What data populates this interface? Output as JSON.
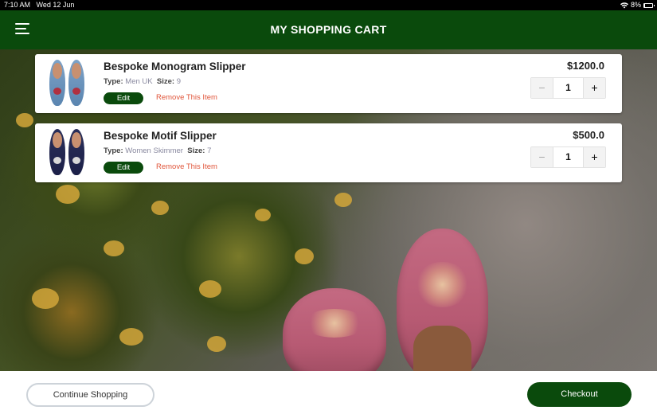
{
  "status_bar": {
    "time": "7:10 AM",
    "date": "Wed 12 Jun",
    "battery": "8%",
    "battery_level": 0.08,
    "wifi_icon": "wifi-icon"
  },
  "header": {
    "title": "MY SHOPPING CART",
    "menu_icon": "hamburger-menu-icon",
    "background_color": "#0a4a0c"
  },
  "cart": {
    "items": [
      {
        "name": "Bespoke Monogram Slipper",
        "type_label": "Type:",
        "type_value": "Men UK",
        "size_label": "Size:",
        "size_value": "9",
        "price": "$1200.0",
        "quantity": "1",
        "edit_label": "Edit",
        "remove_label": "Remove This Item",
        "minus_label": "−",
        "plus_label": "+"
      },
      {
        "name": "Bespoke Motif Slipper",
        "type_label": "Type:",
        "type_value": "Women Skimmer",
        "size_label": "Size:",
        "size_value": "7",
        "price": "$500.0",
        "quantity": "1",
        "edit_label": "Edit",
        "remove_label": "Remove This Item",
        "minus_label": "−",
        "plus_label": "+"
      }
    ]
  },
  "footer": {
    "continue_label": "Continue Shopping",
    "checkout_label": "Checkout"
  },
  "colors": {
    "primary": "#0a4a0c",
    "remove_link": "#e0553a",
    "spec_value": "#8a8aa0"
  }
}
